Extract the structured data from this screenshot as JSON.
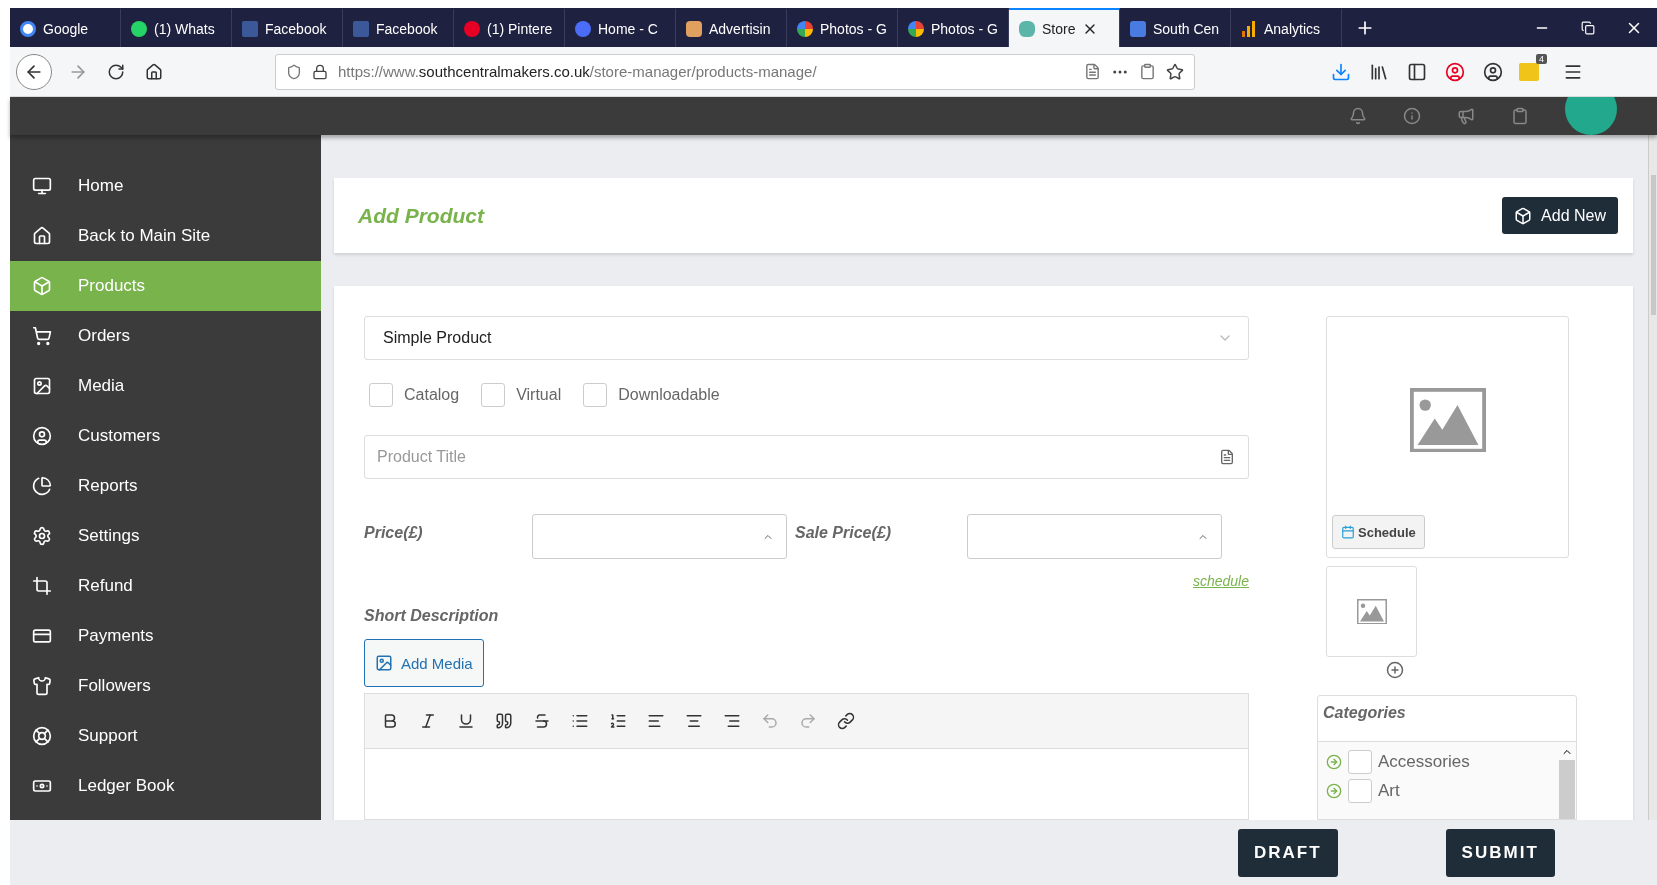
{
  "browser": {
    "tabs": [
      {
        "label": "Google",
        "selected": false
      },
      {
        "label": "(1) Whats",
        "selected": false
      },
      {
        "label": "Facebook",
        "selected": false
      },
      {
        "label": "Facebook",
        "selected": false
      },
      {
        "label": "(1) Pintere",
        "selected": false
      },
      {
        "label": "Home - C",
        "selected": false
      },
      {
        "label": "Advertisin",
        "selected": false
      },
      {
        "label": "Photos - G",
        "selected": false
      },
      {
        "label": "Photos - G",
        "selected": false
      },
      {
        "label": "Store",
        "selected": true
      },
      {
        "label": "South Cen",
        "selected": false
      },
      {
        "label": "Analytics",
        "selected": false
      }
    ],
    "url": {
      "scheme": "https://www.",
      "domain": "southcentralmakers.co.uk",
      "path": "/store-manager/products-manage/"
    },
    "extension_badge": "4"
  },
  "sidebar": {
    "items": [
      {
        "label": "Home",
        "selected": false
      },
      {
        "label": "Back to Main Site",
        "selected": false
      },
      {
        "label": "Products",
        "selected": true
      },
      {
        "label": "Orders",
        "selected": false
      },
      {
        "label": "Media",
        "selected": false
      },
      {
        "label": "Customers",
        "selected": false
      },
      {
        "label": "Reports",
        "selected": false
      },
      {
        "label": "Settings",
        "selected": false
      },
      {
        "label": "Refund",
        "selected": false
      },
      {
        "label": "Payments",
        "selected": false
      },
      {
        "label": "Followers",
        "selected": false
      },
      {
        "label": "Support",
        "selected": false
      },
      {
        "label": "Ledger Book",
        "selected": false
      }
    ]
  },
  "page_header": {
    "title": "Add Product",
    "button": "Add New"
  },
  "form": {
    "product_type": "Simple Product",
    "options": [
      {
        "label": "Catalog",
        "checked": false
      },
      {
        "label": "Virtual",
        "checked": false
      },
      {
        "label": "Downloadable",
        "checked": false
      }
    ],
    "title_placeholder": "Product Title",
    "price_label": "Price(£)",
    "sale_price_label": "Sale Price(£)",
    "schedule_link": "schedule",
    "short_description_label": "Short Description",
    "add_media": "Add Media"
  },
  "image_panel": {
    "schedule_button": "Schedule"
  },
  "categories": {
    "title": "Categories",
    "items": [
      {
        "label": "Accessories",
        "checked": false
      },
      {
        "label": "Art",
        "checked": false
      }
    ]
  },
  "footer": {
    "buttons": [
      "DRAFT",
      "SUBMIT"
    ]
  }
}
